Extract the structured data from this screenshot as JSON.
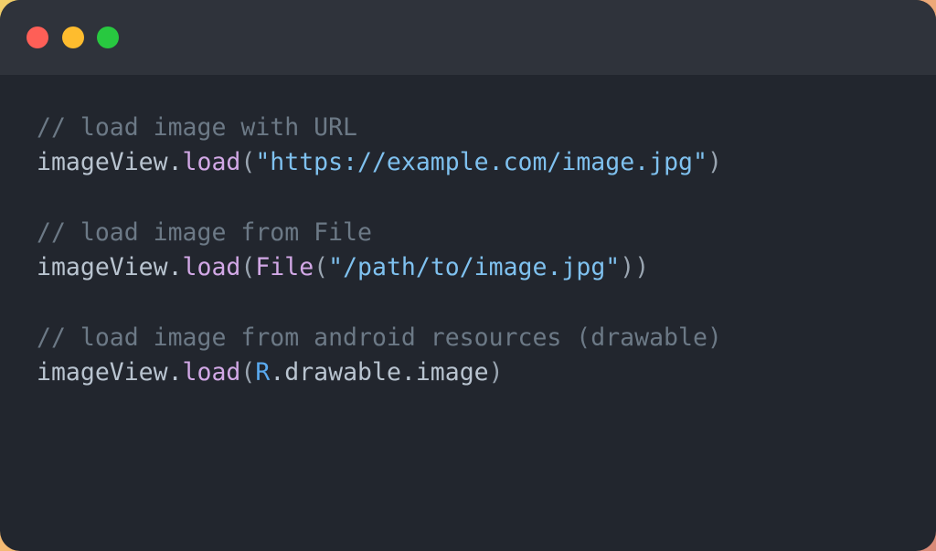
{
  "window": {
    "controls": [
      {
        "name": "close",
        "color": "#fe5f57"
      },
      {
        "name": "minimize",
        "color": "#febc2e"
      },
      {
        "name": "maximize",
        "color": "#28c840"
      }
    ],
    "colors": {
      "titlebar": "#2f333b",
      "body": "#22262e"
    }
  },
  "code": {
    "lines": [
      {
        "tokens": [
          {
            "type": "comment",
            "text": "// load image with URL"
          }
        ]
      },
      {
        "tokens": [
          {
            "type": "ident",
            "text": "imageView."
          },
          {
            "type": "func",
            "text": "load"
          },
          {
            "type": "punct",
            "text": "("
          },
          {
            "type": "string",
            "text": "\"https://example.com/image.jpg\""
          },
          {
            "type": "punct",
            "text": ")"
          }
        ]
      },
      {
        "blank": true
      },
      {
        "tokens": [
          {
            "type": "comment",
            "text": "// load image from File"
          }
        ]
      },
      {
        "tokens": [
          {
            "type": "ident",
            "text": "imageView."
          },
          {
            "type": "func",
            "text": "load"
          },
          {
            "type": "punct",
            "text": "("
          },
          {
            "type": "func",
            "text": "File"
          },
          {
            "type": "punct",
            "text": "("
          },
          {
            "type": "string",
            "text": "\"/path/to/image.jpg\""
          },
          {
            "type": "punct",
            "text": "))"
          }
        ]
      },
      {
        "blank": true
      },
      {
        "tokens": [
          {
            "type": "comment",
            "text": "// load image from android resources (drawable)"
          }
        ]
      },
      {
        "tokens": [
          {
            "type": "ident",
            "text": "imageView."
          },
          {
            "type": "func",
            "text": "load"
          },
          {
            "type": "punct",
            "text": "("
          },
          {
            "type": "class",
            "text": "R"
          },
          {
            "type": "ident",
            "text": ".drawable.image"
          },
          {
            "type": "punct",
            "text": ")"
          }
        ]
      }
    ]
  }
}
